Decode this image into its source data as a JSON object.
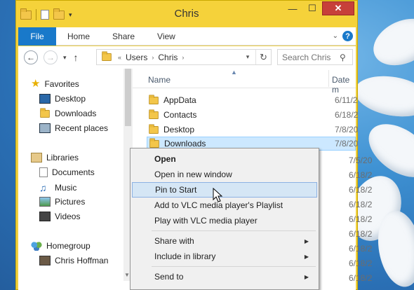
{
  "window": {
    "title": "Chris",
    "minimize_glyph": "—",
    "maximize_glyph": "☐",
    "close_glyph": "✕"
  },
  "ribbon": {
    "tabs": [
      "File",
      "Home",
      "Share",
      "View"
    ],
    "help": "?"
  },
  "nav": {
    "back": "←",
    "forward": "→",
    "up": "↑",
    "breadcrumb": [
      "«",
      "Users",
      "›",
      "Chris",
      "›"
    ],
    "refresh": "↻",
    "search_placeholder": "Search Chris"
  },
  "navpane": {
    "favorites": {
      "label": "Favorites",
      "items": [
        "Desktop",
        "Downloads",
        "Recent places"
      ]
    },
    "libraries": {
      "label": "Libraries",
      "items": [
        "Documents",
        "Music",
        "Pictures",
        "Videos"
      ]
    },
    "homegroup": {
      "label": "Homegroup",
      "items": [
        "Chris Hoffman"
      ]
    }
  },
  "files": {
    "columns": {
      "name": "Name",
      "date": "Date m"
    },
    "rows": [
      {
        "name": "AppData",
        "date": "6/11/2"
      },
      {
        "name": "Contacts",
        "date": "6/18/2"
      },
      {
        "name": "Desktop",
        "date": "7/8/20"
      },
      {
        "name": "Downloads",
        "date": "7/8/20",
        "selected": true
      }
    ],
    "hidden_dates": [
      "7/5/20",
      "6/18/2",
      "6/18/2",
      "6/18/2",
      "6/18/2",
      "6/18/2",
      "6/18/2",
      "6/18/2",
      "6/18/2"
    ]
  },
  "context_menu": {
    "items": [
      {
        "label": "Open",
        "bold": true
      },
      {
        "label": "Open in new window"
      },
      {
        "label": "Pin to Start",
        "hover": true
      },
      {
        "label": "Add to VLC media player's Playlist"
      },
      {
        "label": "Play with VLC media player"
      },
      {
        "label": "Share with",
        "submenu": true
      },
      {
        "label": "Include in library",
        "submenu": true
      },
      {
        "label": "Send to",
        "submenu": true
      }
    ]
  },
  "colors": {
    "title_bar": "#f5d23a",
    "file_tab": "#1979ca",
    "close_button": "#c7403a",
    "selection": "#cce8ff",
    "menu_hover": "#d5e6f5"
  }
}
